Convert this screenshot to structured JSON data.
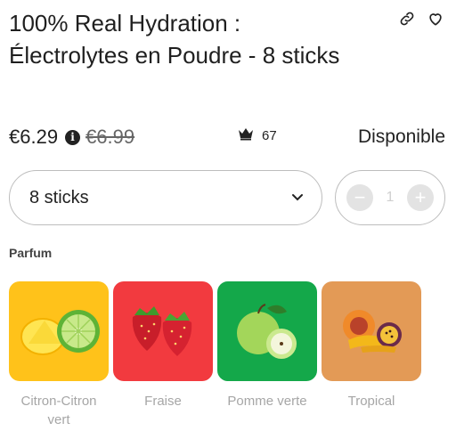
{
  "product": {
    "title": "100% Real Hydration : Électrolytes en Poudre - 8 sticks",
    "price": "€6.29",
    "info_glyph": "i",
    "old_price": "€6.99",
    "rating_count": "67",
    "availability": "Disponible"
  },
  "icons": {
    "share": "link-icon",
    "wishlist": "heart-icon",
    "info": "info-icon",
    "rating": "crown-icon",
    "dropdown": "chevron-down-icon"
  },
  "variant": {
    "selected": "8 sticks"
  },
  "quantity": {
    "minus": "−",
    "value": "1",
    "plus": "+"
  },
  "flavor_section": {
    "label": "Parfum",
    "items": [
      {
        "name": "Citron-Citron vert",
        "color": "#ffc21a"
      },
      {
        "name": "Fraise",
        "color": "#f23a3f"
      },
      {
        "name": "Pomme verte",
        "color": "#14a84a"
      },
      {
        "name": "Tropical",
        "color": "#e39a56"
      }
    ]
  }
}
